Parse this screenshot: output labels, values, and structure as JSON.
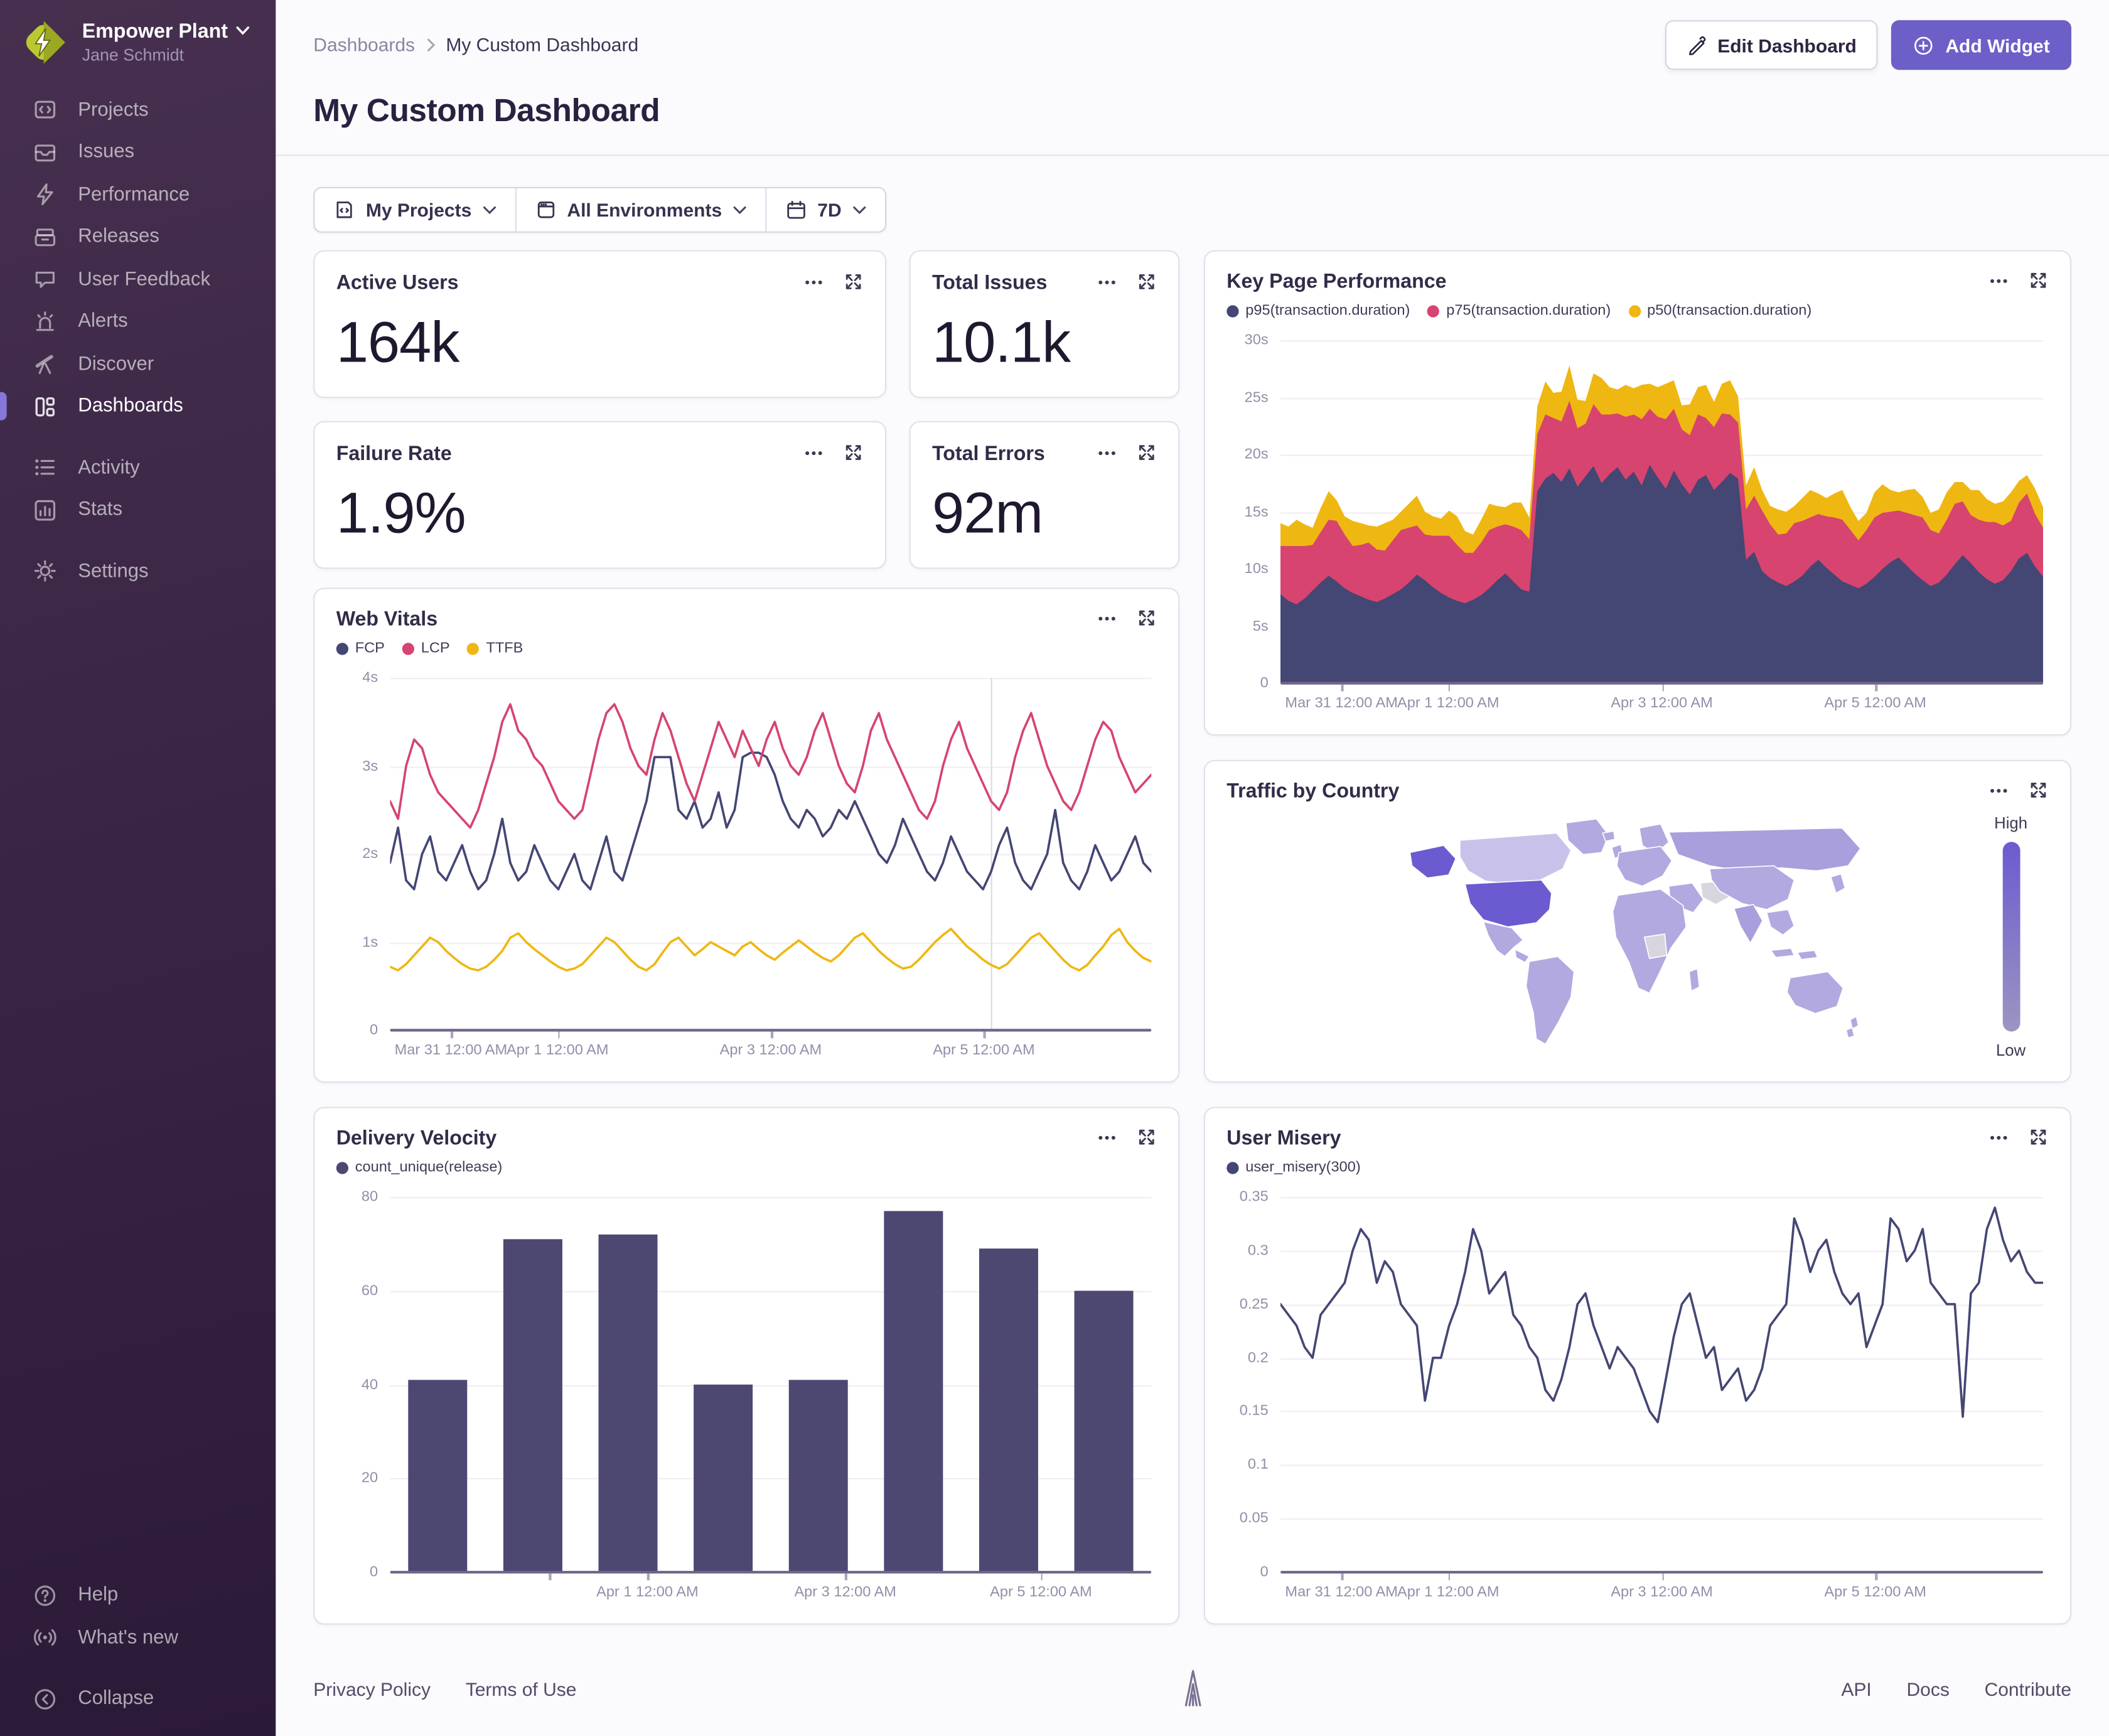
{
  "org": {
    "name": "Empower Plant",
    "user": "Jane Schmidt"
  },
  "sidebar": {
    "items": [
      "Projects",
      "Issues",
      "Performance",
      "Releases",
      "User Feedback",
      "Alerts",
      "Discover",
      "Dashboards",
      "Activity",
      "Stats",
      "Settings"
    ],
    "bottom_items": [
      "Help",
      "What's new",
      "Collapse"
    ]
  },
  "breadcrumb": {
    "root": "Dashboards",
    "current": "My Custom Dashboard"
  },
  "page_title": "My Custom Dashboard",
  "actions": {
    "edit": "Edit Dashboard",
    "add": "Add Widget"
  },
  "filters": {
    "projects": "My Projects",
    "environments": "All Environments",
    "period": "7D"
  },
  "footer": {
    "left": [
      "Privacy Policy",
      "Terms of Use"
    ],
    "right": [
      "API",
      "Docs",
      "Contribute"
    ]
  },
  "colors": {
    "accent": "#6C5FC7",
    "sidebar_top": "#47304F",
    "sidebar_bottom": "#2B1A37",
    "series_navy": "#444674",
    "series_pink": "#D6446F",
    "series_yellow": "#EFB712",
    "axis_text": "#958DA8",
    "grid": "#F0EDF4"
  },
  "chart_data": [
    {
      "id": "active_users",
      "type": "big_number",
      "title": "Active Users",
      "value": "164k"
    },
    {
      "id": "total_issues",
      "type": "big_number",
      "title": "Total Issues",
      "value": "10.1k"
    },
    {
      "id": "failure_rate",
      "type": "big_number",
      "title": "Failure Rate",
      "value": "1.9%"
    },
    {
      "id": "total_errors",
      "type": "big_number",
      "title": "Total Errors",
      "value": "92m"
    },
    {
      "id": "key_page_performance",
      "type": "area",
      "title": "Key Page Performance",
      "stacked": true,
      "ylim": [
        0,
        30
      ],
      "yticks": [
        {
          "v": 0,
          "label": "0"
        },
        {
          "v": 5,
          "label": "5s"
        },
        {
          "v": 10,
          "label": "10s"
        },
        {
          "v": 15,
          "label": "15s"
        },
        {
          "v": 20,
          "label": "20s"
        },
        {
          "v": 25,
          "label": "25s"
        },
        {
          "v": 30,
          "label": "30s"
        }
      ],
      "xticks": [
        {
          "f": 0.08,
          "label": "Mar 31 12:00 AM"
        },
        {
          "f": 0.22,
          "label": "Apr 1 12:00 AM"
        },
        {
          "f": 0.5,
          "label": "Apr 3 12:00 AM"
        },
        {
          "f": 0.78,
          "label": "Apr 5 12:00 AM"
        }
      ],
      "series": [
        {
          "name": "p95(transaction.duration)",
          "color": "#444674",
          "values": [
            7.8,
            7.2,
            6.9,
            7.4,
            8.1,
            8.8,
            9.4,
            8.9,
            8.3,
            7.9,
            7.6,
            7.3,
            7.1,
            7.4,
            7.8,
            8.2,
            8.8,
            9.5,
            9.0,
            8.4,
            7.9,
            7.5,
            7.2,
            7.0,
            7.3,
            7.7,
            8.3,
            9.0,
            9.6,
            8.9,
            8.2,
            8.0,
            16.8,
            17.9,
            18.4,
            17.6,
            18.8,
            17.2,
            18.1,
            19.0,
            17.5,
            18.3,
            18.9,
            17.8,
            18.5,
            17.3,
            19.1,
            18.0,
            17.0,
            18.6,
            17.4,
            16.5,
            17.8,
            18.2,
            16.9,
            17.6,
            18.4,
            17.9,
            10.8,
            11.5,
            9.8,
            9.2,
            8.8,
            8.5,
            8.9,
            9.4,
            10.2,
            10.8,
            10.1,
            9.5,
            8.9,
            8.6,
            8.3,
            8.7,
            9.3,
            10.0,
            10.6,
            11.0,
            10.3,
            9.6,
            9.0,
            8.5,
            8.8,
            9.5,
            10.4,
            11.2,
            10.5,
            9.7,
            9.1,
            8.7,
            9.0,
            9.8,
            10.9,
            11.4,
            10.2,
            9.3
          ]
        },
        {
          "name": "p75(transaction.duration)",
          "color": "#D6446F",
          "values": [
            4.2,
            4.8,
            5.1,
            4.6,
            4.0,
            4.4,
            4.9,
            5.3,
            4.7,
            4.1,
            4.5,
            5.0,
            4.6,
            4.2,
            4.7,
            5.2,
            4.8,
            4.3,
            4.0,
            4.5,
            5.0,
            5.4,
            4.9,
            4.4,
            4.1,
            4.6,
            5.1,
            4.7,
            4.3,
            4.8,
            5.2,
            4.6,
            5.0,
            5.6,
            4.8,
            5.3,
            5.9,
            5.1,
            4.6,
            5.4,
            6.0,
            5.2,
            4.7,
            5.5,
            5.0,
            5.8,
            4.9,
            5.3,
            6.1,
            5.4,
            4.8,
            5.2,
            5.7,
            5.0,
            5.5,
            6.0,
            5.1,
            4.9,
            4.4,
            4.9,
            5.3,
            4.7,
            4.2,
            4.6,
            5.1,
            4.8,
            4.3,
            4.0,
            4.5,
            5.0,
            5.4,
            4.8,
            4.2,
            4.7,
            5.2,
            4.9,
            4.4,
            4.1,
            4.6,
            5.1,
            5.5,
            4.9,
            4.3,
            4.8,
            5.3,
            4.7,
            4.2,
            4.6,
            5.0,
            5.4,
            4.8,
            4.4,
            4.9,
            5.2,
            4.6,
            4.3
          ]
        },
        {
          "name": "p50(transaction.duration)",
          "color": "#EFB712",
          "values": [
            2.0,
            1.7,
            2.3,
            1.9,
            1.5,
            2.1,
            2.5,
            1.8,
            1.6,
            2.2,
            1.9,
            1.5,
            2.0,
            2.4,
            1.8,
            1.6,
            2.1,
            2.6,
            2.0,
            1.7,
            1.5,
            2.2,
            2.5,
            1.9,
            1.6,
            2.0,
            2.3,
            1.8,
            1.5,
            2.1,
            2.4,
            1.9,
            2.4,
            2.9,
            2.2,
            2.6,
            3.1,
            2.5,
            2.0,
            2.7,
            3.2,
            2.4,
            2.1,
            2.8,
            2.3,
            3.0,
            2.2,
            2.6,
            3.1,
            2.5,
            2.1,
            2.7,
            2.4,
            2.9,
            2.2,
            2.6,
            3.0,
            2.3,
            2.1,
            2.5,
            1.8,
            1.6,
            2.2,
            1.9,
            1.5,
            2.0,
            2.4,
            1.8,
            1.6,
            2.1,
            2.6,
            2.0,
            1.7,
            1.5,
            2.2,
            2.5,
            1.9,
            1.6,
            2.0,
            2.3,
            1.8,
            1.5,
            2.1,
            2.4,
            1.9,
            1.7,
            2.2,
            2.6,
            2.0,
            1.6,
            2.1,
            2.5,
            1.9,
            1.6,
            2.2,
            1.8
          ]
        }
      ]
    },
    {
      "id": "web_vitals",
      "type": "line",
      "title": "Web Vitals",
      "ylim": [
        0,
        4
      ],
      "vline": 0.79,
      "yticks": [
        {
          "v": 0,
          "label": "0"
        },
        {
          "v": 1,
          "label": "1s"
        },
        {
          "v": 2,
          "label": "2s"
        },
        {
          "v": 3,
          "label": "3s"
        },
        {
          "v": 4,
          "label": "4s"
        }
      ],
      "xticks": [
        {
          "f": 0.08,
          "label": "Mar 31 12:00 AM"
        },
        {
          "f": 0.22,
          "label": "Apr 1 12:00 AM"
        },
        {
          "f": 0.5,
          "label": "Apr 3 12:00 AM"
        },
        {
          "f": 0.78,
          "label": "Apr 5 12:00 AM"
        }
      ],
      "series": [
        {
          "name": "FCP",
          "color": "#444674",
          "values": [
            1.9,
            2.3,
            1.7,
            1.6,
            2.0,
            2.2,
            1.8,
            1.7,
            1.9,
            2.1,
            1.8,
            1.6,
            1.7,
            2.0,
            2.4,
            1.9,
            1.7,
            1.8,
            2.1,
            1.9,
            1.7,
            1.6,
            1.8,
            2.0,
            1.7,
            1.6,
            1.9,
            2.2,
            1.8,
            1.7,
            2.0,
            2.3,
            2.6,
            3.1,
            3.1,
            3.1,
            2.5,
            2.4,
            2.6,
            2.3,
            2.4,
            2.7,
            2.3,
            2.5,
            3.1,
            3.15,
            3.15,
            3.1,
            2.9,
            2.6,
            2.4,
            2.3,
            2.5,
            2.4,
            2.2,
            2.3,
            2.5,
            2.4,
            2.6,
            2.4,
            2.2,
            2.0,
            1.9,
            2.1,
            2.4,
            2.2,
            2.0,
            1.8,
            1.7,
            1.9,
            2.2,
            2.0,
            1.8,
            1.7,
            1.6,
            1.8,
            2.1,
            2.3,
            1.9,
            1.7,
            1.6,
            1.8,
            2.0,
            2.5,
            1.9,
            1.7,
            1.6,
            1.8,
            2.1,
            1.9,
            1.7,
            1.8,
            2.0,
            2.2,
            1.9,
            1.8
          ]
        },
        {
          "name": "LCP",
          "color": "#D6446F",
          "values": [
            2.6,
            2.4,
            3.0,
            3.3,
            3.2,
            2.9,
            2.7,
            2.6,
            2.5,
            2.4,
            2.3,
            2.5,
            2.8,
            3.1,
            3.5,
            3.7,
            3.4,
            3.3,
            3.1,
            3.0,
            2.8,
            2.6,
            2.5,
            2.4,
            2.5,
            2.9,
            3.3,
            3.6,
            3.7,
            3.5,
            3.2,
            3.0,
            2.9,
            3.3,
            3.6,
            3.4,
            3.1,
            2.8,
            2.6,
            2.9,
            3.2,
            3.5,
            3.3,
            3.1,
            3.4,
            3.2,
            3.0,
            3.3,
            3.5,
            3.2,
            3.0,
            2.9,
            3.1,
            3.4,
            3.6,
            3.3,
            3.0,
            2.8,
            2.7,
            3.0,
            3.4,
            3.6,
            3.3,
            3.1,
            2.9,
            2.7,
            2.5,
            2.4,
            2.6,
            3.0,
            3.3,
            3.5,
            3.2,
            3.0,
            2.8,
            2.6,
            2.5,
            2.7,
            3.1,
            3.4,
            3.6,
            3.3,
            3.0,
            2.8,
            2.6,
            2.5,
            2.7,
            3.0,
            3.3,
            3.5,
            3.4,
            3.1,
            2.9,
            2.7,
            2.8,
            2.9
          ]
        },
        {
          "name": "TTFB",
          "color": "#EFB712",
          "values": [
            0.72,
            0.68,
            0.75,
            0.85,
            0.95,
            1.05,
            1.0,
            0.9,
            0.82,
            0.75,
            0.7,
            0.68,
            0.72,
            0.8,
            0.9,
            1.05,
            1.1,
            1.0,
            0.92,
            0.85,
            0.78,
            0.72,
            0.68,
            0.7,
            0.75,
            0.85,
            0.95,
            1.05,
            1.0,
            0.9,
            0.8,
            0.72,
            0.68,
            0.75,
            0.88,
            1.0,
            1.05,
            0.95,
            0.85,
            0.92,
            1.0,
            0.95,
            0.9,
            0.85,
            0.95,
            1.0,
            0.92,
            0.85,
            0.8,
            0.88,
            0.95,
            1.02,
            0.95,
            0.88,
            0.82,
            0.78,
            0.85,
            0.95,
            1.05,
            1.1,
            1.0,
            0.9,
            0.82,
            0.75,
            0.7,
            0.72,
            0.8,
            0.9,
            1.0,
            1.08,
            1.15,
            1.05,
            0.95,
            0.88,
            0.8,
            0.74,
            0.7,
            0.75,
            0.85,
            0.95,
            1.05,
            1.1,
            1.0,
            0.9,
            0.8,
            0.72,
            0.68,
            0.74,
            0.85,
            0.95,
            1.08,
            1.15,
            1.0,
            0.9,
            0.82,
            0.78
          ]
        }
      ]
    },
    {
      "id": "traffic_by_country",
      "type": "map",
      "title": "Traffic by Country",
      "scale_high_label": "High",
      "scale_low_label": "Low",
      "palette": {
        "base": "#B2A9E0",
        "high": "#6A5BD0",
        "light": "#C8C2EB",
        "mid": "#A99FDC",
        "gray": "#D8D5DE"
      },
      "legend_low_color": "#9C95C1"
    },
    {
      "id": "delivery_velocity",
      "type": "bar",
      "title": "Delivery Velocity",
      "ylim": [
        0,
        80
      ],
      "yticks": [
        {
          "v": 0,
          "label": "0"
        },
        {
          "v": 20,
          "label": "20"
        },
        {
          "v": 40,
          "label": "40"
        },
        {
          "v": 60,
          "label": "60"
        },
        {
          "v": 80,
          "label": "80"
        }
      ],
      "xticks": [
        {
          "f": 0.209,
          "label": ""
        },
        {
          "f": 0.338,
          "label": "Apr 1 12:00 AM"
        },
        {
          "f": 0.598,
          "label": "Apr 3 12:00 AM"
        },
        {
          "f": 0.855,
          "label": "Apr 5 12:00 AM"
        }
      ],
      "series": [
        {
          "name": "count_unique(release)",
          "color": "#4D4872",
          "values": [
            41,
            71,
            72,
            40,
            41,
            77,
            69,
            60
          ]
        }
      ]
    },
    {
      "id": "user_misery",
      "type": "line",
      "title": "User Misery",
      "ylim": [
        0,
        0.35
      ],
      "yticks": [
        {
          "v": 0,
          "label": "0"
        },
        {
          "v": 0.05,
          "label": "0.05"
        },
        {
          "v": 0.1,
          "label": "0.1"
        },
        {
          "v": 0.15,
          "label": "0.15"
        },
        {
          "v": 0.2,
          "label": "0.2"
        },
        {
          "v": 0.25,
          "label": "0.25"
        },
        {
          "v": 0.3,
          "label": "0.3"
        },
        {
          "v": 0.35,
          "label": "0.35"
        }
      ],
      "xticks": [
        {
          "f": 0.08,
          "label": "Mar 31 12:00 AM"
        },
        {
          "f": 0.22,
          "label": "Apr 1 12:00 AM"
        },
        {
          "f": 0.5,
          "label": "Apr 3 12:00 AM"
        },
        {
          "f": 0.78,
          "label": "Apr 5 12:00 AM"
        }
      ],
      "series": [
        {
          "name": "user_misery(300)",
          "color": "#444674",
          "values": [
            0.25,
            0.24,
            0.23,
            0.21,
            0.2,
            0.24,
            0.25,
            0.26,
            0.27,
            0.3,
            0.32,
            0.31,
            0.27,
            0.29,
            0.28,
            0.25,
            0.24,
            0.23,
            0.16,
            0.2,
            0.2,
            0.23,
            0.25,
            0.28,
            0.32,
            0.3,
            0.26,
            0.27,
            0.28,
            0.24,
            0.23,
            0.21,
            0.2,
            0.17,
            0.16,
            0.18,
            0.21,
            0.25,
            0.26,
            0.23,
            0.21,
            0.19,
            0.21,
            0.2,
            0.19,
            0.17,
            0.15,
            0.14,
            0.18,
            0.22,
            0.25,
            0.26,
            0.23,
            0.2,
            0.21,
            0.17,
            0.18,
            0.19,
            0.16,
            0.17,
            0.19,
            0.23,
            0.24,
            0.25,
            0.33,
            0.31,
            0.28,
            0.3,
            0.31,
            0.28,
            0.26,
            0.25,
            0.26,
            0.21,
            0.23,
            0.25,
            0.33,
            0.32,
            0.29,
            0.3,
            0.32,
            0.27,
            0.26,
            0.25,
            0.25,
            0.145,
            0.26,
            0.27,
            0.32,
            0.34,
            0.31,
            0.29,
            0.3,
            0.28,
            0.27,
            0.27
          ]
        }
      ]
    }
  ]
}
